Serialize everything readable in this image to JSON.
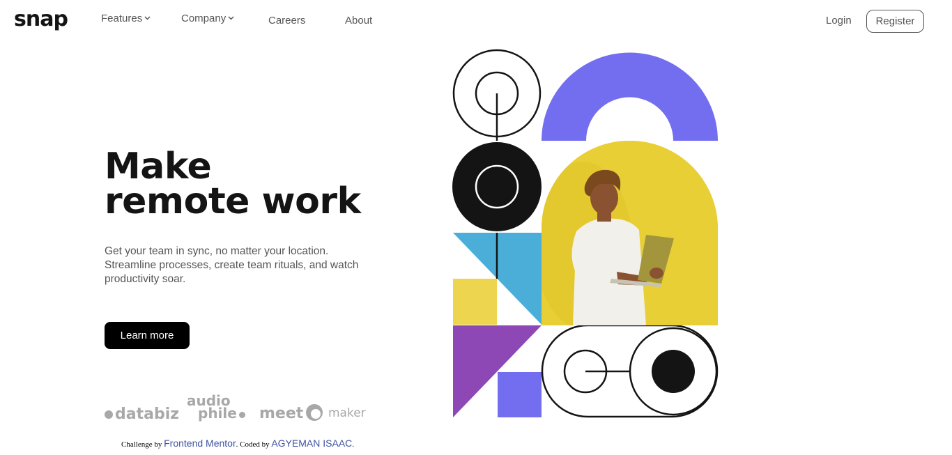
{
  "header": {
    "logo": "snap",
    "nav": [
      {
        "label": "Features"
      },
      {
        "label": "Company"
      },
      {
        "label": "Careers"
      },
      {
        "label": "About"
      }
    ],
    "login": "Login",
    "register": "Register",
    "chevron_icon": "chevron-down-icon"
  },
  "hero": {
    "title_line1": "Make",
    "title_line2": "remote work",
    "description": "Get your team in sync, no matter your location. Streamline processes, create team rituals, and watch productivity soar.",
    "cta": "Learn more"
  },
  "clients": {
    "databiz": "databiz",
    "audiophile_top": "audio",
    "audiophile_bottom": "phile",
    "meet": "meet",
    "maker": "maker"
  },
  "attribution": {
    "prefix": "Challenge by",
    "mentor": "Frontend Mentor",
    "middle": ". Coded by",
    "author": "AGYEMAN ISAAC",
    "suffix": "."
  },
  "colors": {
    "accent_purple": "#736ef0",
    "blue": "#4aaed9",
    "yellow": "#eed54f",
    "violet": "#8d48b6",
    "photo_bg": "#e7cf35"
  }
}
